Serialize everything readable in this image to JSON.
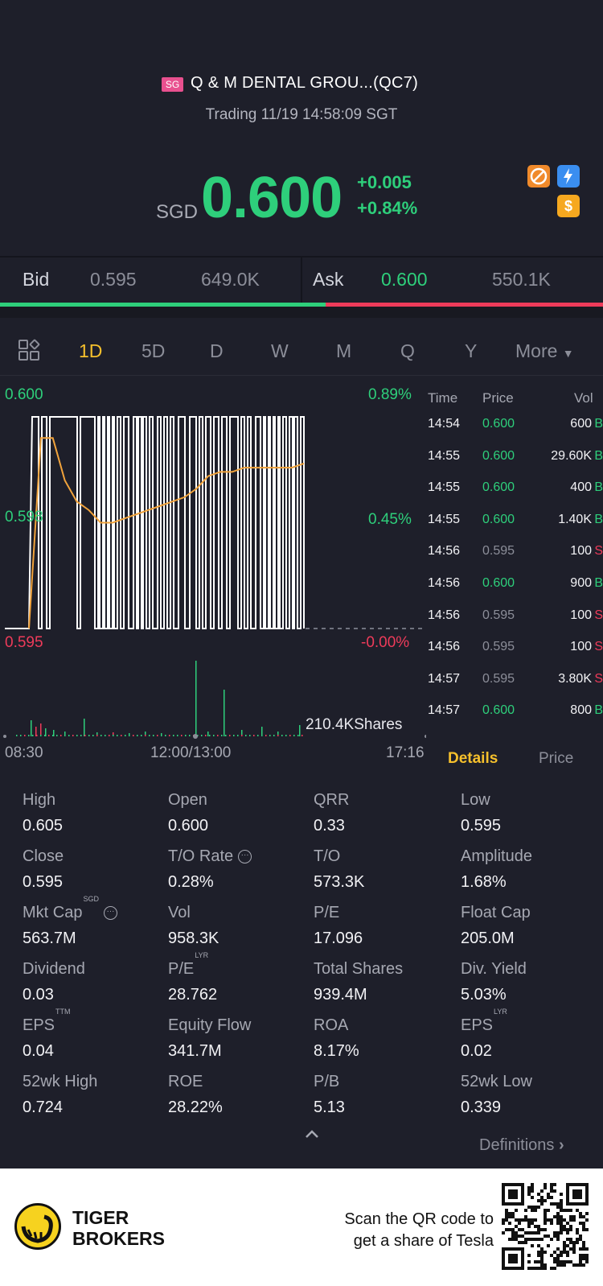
{
  "header": {
    "market_tag": "SG",
    "stock_name": "Q & M DENTAL GROU...(QC7)",
    "status": "Trading 11/19 14:58:09 SGT"
  },
  "quote": {
    "currency": "SGD",
    "price": "0.600",
    "change": "+0.005",
    "change_pct": "+0.84%",
    "icons": [
      "no-entry-icon",
      "lightning-icon",
      "dollar-icon"
    ]
  },
  "bidask": {
    "bid_label": "Bid",
    "bid_price": "0.595",
    "bid_vol": "649.0K",
    "ask_label": "Ask",
    "ask_price": "0.600",
    "ask_vol": "550.1K",
    "bid_ratio": 0.54
  },
  "tabs": [
    {
      "label": "1D",
      "active": true
    },
    {
      "label": "5D"
    },
    {
      "label": "D"
    },
    {
      "label": "W"
    },
    {
      "label": "M"
    },
    {
      "label": "Q"
    },
    {
      "label": "Y"
    },
    {
      "label": "More"
    }
  ],
  "chart": {
    "y_top": "0.600",
    "y_mid": "0.598",
    "y_bot": "0.595",
    "pct_top": "0.89%",
    "pct_mid": "0.45%",
    "pct_bot": "-0.00%",
    "volume_label": "210.4KShares",
    "x_start": "08:30",
    "x_mid": "12:00/13:00",
    "x_end": "17:16"
  },
  "chart_data": {
    "type": "line",
    "series": [
      {
        "values": [
          0.595,
          0.6,
          0.6,
          0.595,
          0.6,
          0.595,
          0.6,
          0.595,
          0.6,
          0.6,
          0.595,
          0.6,
          0.595,
          0.6,
          0.595,
          0.6,
          0.595,
          0.6,
          0.595,
          0.6,
          0.595,
          0.6,
          0.6,
          0.595,
          0.6,
          0.595,
          0.6
        ]
      },
      {
        "values": [
          0.595,
          0.5995,
          0.5995,
          0.5985,
          0.598,
          0.5978,
          0.5975,
          0.5975,
          0.5976,
          0.5977,
          0.5978,
          0.5979,
          0.598,
          0.5981,
          0.5983,
          0.5986,
          0.5987,
          0.5987,
          0.5988,
          0.5988,
          0.5988,
          0.5988,
          0.5988,
          0.5989
        ]
      }
    ],
    "ylim": [
      0.595,
      0.6
    ]
  },
  "trades": {
    "headers": [
      "Time",
      "Price",
      "Vol"
    ],
    "rows": [
      {
        "time": "14:54",
        "price": "0.600",
        "vol": "600",
        "side": "B"
      },
      {
        "time": "14:55",
        "price": "0.600",
        "vol": "29.60K",
        "side": "B"
      },
      {
        "time": "14:55",
        "price": "0.600",
        "vol": "400",
        "side": "B"
      },
      {
        "time": "14:55",
        "price": "0.600",
        "vol": "1.40K",
        "side": "B"
      },
      {
        "time": "14:56",
        "price": "0.595",
        "vol": "100",
        "side": "S"
      },
      {
        "time": "14:56",
        "price": "0.600",
        "vol": "900",
        "side": "B"
      },
      {
        "time": "14:56",
        "price": "0.595",
        "vol": "100",
        "side": "S"
      },
      {
        "time": "14:56",
        "price": "0.595",
        "vol": "100",
        "side": "S"
      },
      {
        "time": "14:57",
        "price": "0.595",
        "vol": "3.80K",
        "side": "S"
      },
      {
        "time": "14:57",
        "price": "0.600",
        "vol": "800",
        "side": "B"
      }
    ],
    "tab_details": "Details",
    "tab_price": "Price"
  },
  "stats": [
    {
      "label": "High",
      "value": "0.605"
    },
    {
      "label": "Open",
      "value": "0.600"
    },
    {
      "label": "QRR",
      "value": "0.33"
    },
    {
      "label": "Low",
      "value": "0.595"
    },
    {
      "label": "Close",
      "value": "0.595"
    },
    {
      "label": "T/O Rate",
      "value": "0.28%",
      "info": true
    },
    {
      "label": "T/O",
      "value": "573.3K"
    },
    {
      "label": "Amplitude",
      "value": "1.68%"
    },
    {
      "label": "Mkt Cap",
      "value": "563.7M",
      "sup": "SGD",
      "info": true
    },
    {
      "label": "Vol",
      "value": "958.3K"
    },
    {
      "label": "P/E",
      "value": "17.096"
    },
    {
      "label": "Float Cap",
      "value": "205.0M"
    },
    {
      "label": "Dividend",
      "value": "0.03"
    },
    {
      "label": "P/E",
      "value": "28.762",
      "sup": "LYR"
    },
    {
      "label": "Total Shares",
      "value": "939.4M"
    },
    {
      "label": "Div. Yield",
      "value": "5.03%"
    },
    {
      "label": "EPS",
      "value": "0.04",
      "sup": "TTM"
    },
    {
      "label": "Equity Flow",
      "value": "341.7M"
    },
    {
      "label": "ROA",
      "value": "8.17%"
    },
    {
      "label": "EPS",
      "value": "0.02",
      "sup": "LYR"
    },
    {
      "label": "52wk High",
      "value": "0.724"
    },
    {
      "label": "ROE",
      "value": "28.22%"
    },
    {
      "label": "P/B",
      "value": "5.13"
    },
    {
      "label": "52wk Low",
      "value": "0.339"
    }
  ],
  "definitions": "Definitions",
  "footer": {
    "brand_line1": "TIGER",
    "brand_line2": "BROKERS",
    "promo_line1": "Scan the QR code to",
    "promo_line2": "get a share of Tesla"
  }
}
